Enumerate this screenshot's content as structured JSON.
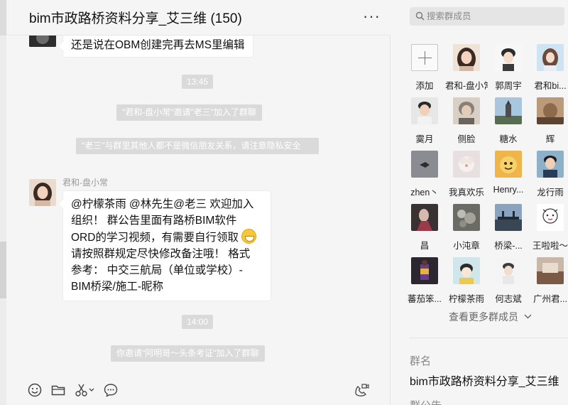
{
  "chat": {
    "title": "bim市政路桥资料分享_艾三维 (150)",
    "more_icon": "more-horizontal-icon",
    "messages": {
      "first_bubble": "还是说在OBM创建完再去MS里编辑",
      "time1": "13:45",
      "sys_invite": "\"君和-盘小常\"邀请\"老三\"加入了群聊",
      "sys_privacy": "\"老三\"与群里其他人都不是微信朋友关系，请注意隐私安全",
      "sender": "君和-盘小常",
      "main_bubble_lines": [
        "@柠檬茶雨 @林先生@老三  欢迎加入",
        "组织！ 群公告里面有路桥BIM软件",
        "ORD的学习视频，有需要自行领取",
        "请按照群规定尽快修改备注哦！ 格式",
        "参考： 中交三航局（单位或学校）-",
        "BIM桥梁/施工-昵称"
      ],
      "time2": "14:00",
      "sys_invite2": "你邀请\"阿明哥～头条考证\"加入了群聊"
    },
    "toolbar": {
      "emoji_icon": "emoji-icon",
      "folder_icon": "folder-icon",
      "scissors_icon": "scissors-icon",
      "chat_bubble_icon": "chat-bubble-icon",
      "video_call_icon": "video-call-icon"
    }
  },
  "members_panel": {
    "search_placeholder": "搜索群成员",
    "members": [
      {
        "name": "添加",
        "kind": "add"
      },
      {
        "name": "君和-盘小常"
      },
      {
        "name": "郭周宇"
      },
      {
        "name": "君和bi..."
      },
      {
        "name": "霙月"
      },
      {
        "name": "侧脸"
      },
      {
        "name": "糖水"
      },
      {
        "name": "辉"
      },
      {
        "name": "zhen丶"
      },
      {
        "name": "我真欢乐"
      },
      {
        "name": "Henry..."
      },
      {
        "name": "龙行雨"
      },
      {
        "name": "昌"
      },
      {
        "name": "小沌章"
      },
      {
        "name": "桥梁-..."
      },
      {
        "name": "王啦啦～"
      },
      {
        "name": "蕃茄笨..."
      },
      {
        "name": "柠檬茶雨"
      },
      {
        "name": "何志斌"
      },
      {
        "name": "广州君..."
      }
    ],
    "more_label": "查看更多群成员",
    "group_name_label": "群名",
    "group_name_value": "bim市政路桥资料分享_艾三维",
    "group_notice_label": "群公告"
  },
  "colors": {
    "background": "#f5f5f5",
    "bubble": "#ffffff",
    "system_chip": "#dadada"
  }
}
